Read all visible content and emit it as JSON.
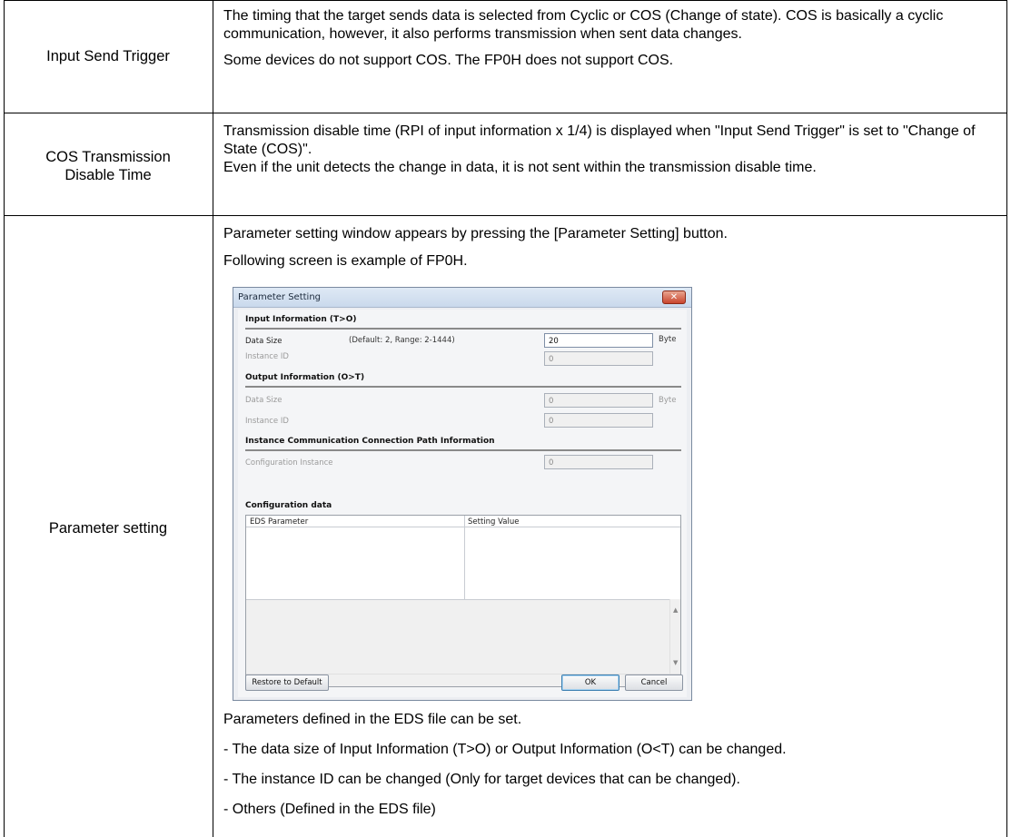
{
  "rows": [
    {
      "label": "Input Send Trigger",
      "paragraphs": [
        "The timing that the target sends data is selected from Cyclic or COS (Change of state). COS is basically a cyclic communication, however, it also performs transmission when sent data changes.",
        "Some devices do not support COS. The FP0H does not support COS."
      ]
    },
    {
      "label_lines": [
        "COS Transmission",
        "Disable Time"
      ],
      "paragraphs": [
        "Transmission disable time  (RPI of input information x 1/4) is displayed when \"Input Send Trigger\" is set to \"Change of State (COS)\".",
        "Even if the unit detects the change in data, it is not sent within the transmission disable time."
      ]
    },
    {
      "label": "Parameter setting",
      "intro": [
        "Parameter setting window appears by pressing the [Parameter Setting] button.",
        "Following screen is example of FP0H."
      ],
      "after": [
        "Parameters defined in the EDS file can be set.",
        "- The data size of Input Information (T>O) or Output Information (O<T) can be changed.",
        "- The instance ID can be changed (Only for target devices that can be changed).",
        "- Others (Defined in the EDS file)"
      ]
    }
  ],
  "dialog": {
    "title": "Parameter Setting",
    "close_glyph": "✕",
    "input_section": "Input Information (T>O)",
    "data_size_label": "Data Size",
    "data_size_hint": "(Default: 2, Range: 2-1444)",
    "input_data_size": "20",
    "byte_unit": "Byte",
    "instance_id_label": "Instance ID",
    "input_instance_id": "0",
    "output_section": "Output Information (O>T)",
    "output_data_size": "0",
    "output_instance_id": "0",
    "path_section": "Instance Communication Connection Path Information",
    "config_instance_label": "Configuration Instance",
    "config_instance": "0",
    "config_data_section": "Configuration data",
    "col_eds_parameter": "EDS Parameter",
    "col_setting_value": "Setting Value",
    "restore_button": "Restore to Default",
    "ok_button": "OK",
    "cancel_button": "Cancel"
  }
}
